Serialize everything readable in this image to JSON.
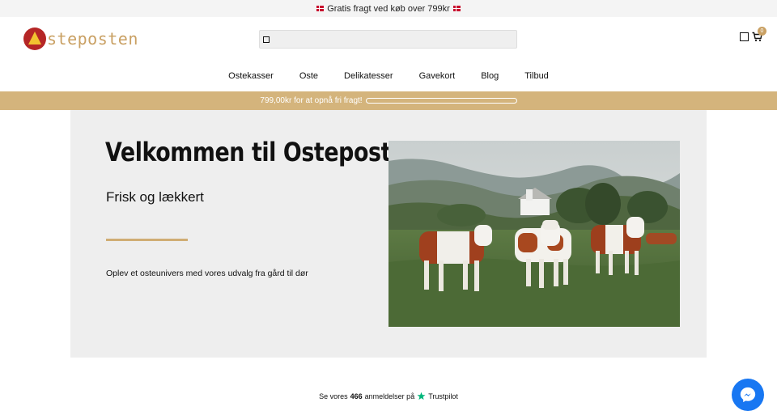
{
  "topbar": {
    "text": "Gratis fragt ved køb over 799kr"
  },
  "header": {
    "logo_text": "steposten",
    "cart_count": "0"
  },
  "nav": {
    "items": [
      "Ostekasser",
      "Oste",
      "Delikatesser",
      "Gavekort",
      "Blog",
      "Tilbud"
    ]
  },
  "shipping_bar": {
    "text": "799,00kr for at opnå fri fragt!",
    "progress": 0
  },
  "hero": {
    "title": "Velkommen til Osteposten",
    "subtitle": "Frisk og lækkert",
    "description": "Oplev et osteunivers med vores udvalg fra gård til dør"
  },
  "reviews": {
    "prefix": "Se vores",
    "count": "466",
    "middle": "anmeldelser på",
    "brand": "Trustpilot"
  },
  "colors": {
    "accent": "#d4b47c",
    "logo_red": "#b52626",
    "messenger_blue": "#1877f2",
    "trustpilot_green": "#00b67a"
  },
  "icons": {
    "search": "search-icon",
    "account": "account-icon",
    "cart": "cart-icon",
    "messenger": "messenger-icon"
  }
}
